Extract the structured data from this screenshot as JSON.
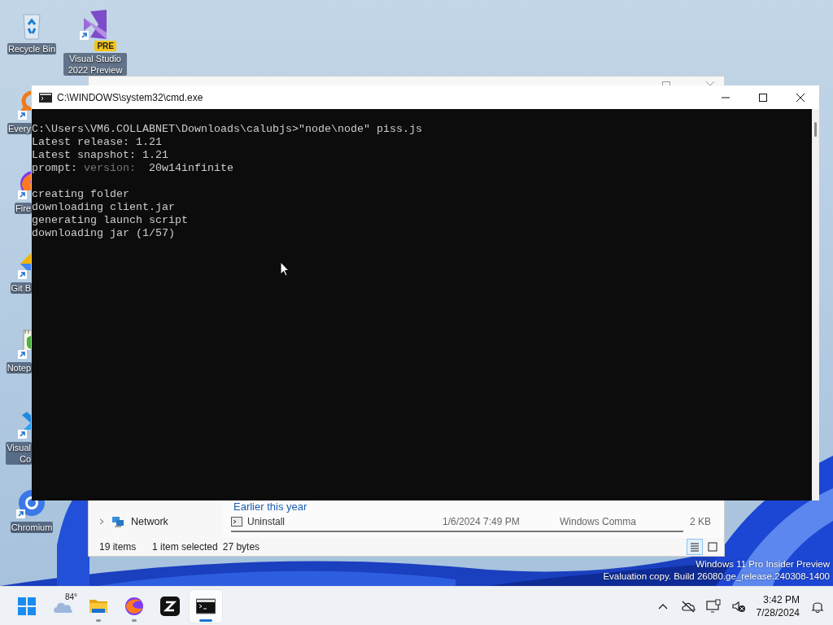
{
  "desktop_icons": [
    {
      "kind": "recycle-bin",
      "label": "Recycle Bin",
      "shortcut": false,
      "covered": false
    },
    {
      "kind": "magnifier",
      "label": "Every",
      "shortcut": true,
      "covered": true
    },
    {
      "kind": "fox",
      "label": "Fire",
      "shortcut": true,
      "covered": true
    },
    {
      "kind": "diamond",
      "label": "Git B",
      "shortcut": true,
      "covered": true
    },
    {
      "kind": "notepad",
      "label": "Notep",
      "shortcut": true,
      "covered": true
    },
    {
      "kind": "x-logo",
      "label": "Visual\nCo",
      "shortcut": true,
      "covered": true
    },
    {
      "kind": "ring",
      "label": "Chromium",
      "shortcut": true,
      "covered": false
    },
    {
      "kind": "ribbon",
      "label": "Visual Studio 2022 Preview",
      "badge": "PRE",
      "shortcut": true,
      "covered": false
    }
  ],
  "explorer_window": {
    "navigation": [
      {
        "label": "Network",
        "expanded": false
      }
    ],
    "group_header": "Earlier this year",
    "files": [
      {
        "name": "Uninstall",
        "date_modified": "1/6/2024 7:49 PM",
        "type": "Windows Comma",
        "size": "2 KB"
      }
    ],
    "status_bar": {
      "item_count": "19 items",
      "selection": "1 item selected",
      "selection_size": "27 bytes"
    },
    "view_buttons": [
      {
        "kind": "details",
        "selected": true
      },
      {
        "kind": "tiles",
        "selected": false
      }
    ]
  },
  "cmd_window": {
    "title": "C:\\WINDOWS\\system32\\cmd.exe",
    "lines": [
      {
        "segments": [
          {
            "text": "C:\\Users\\VM6.COLLABNET\\Downloads\\calubjs>\"node\\node\" piss.js",
            "dim": false
          }
        ]
      },
      {
        "segments": [
          {
            "text": "Latest release: 1.21",
            "dim": false
          }
        ]
      },
      {
        "segments": [
          {
            "text": "Latest snapshot: 1.21",
            "dim": false
          }
        ]
      },
      {
        "segments": [
          {
            "text": "prompt: ",
            "dim": false
          },
          {
            "text": "version: ",
            "dim": true
          },
          {
            "text": " 20w14infinite",
            "dim": false
          }
        ]
      },
      {
        "space_before": true,
        "segments": [
          {
            "text": "creating folder",
            "dim": false
          }
        ]
      },
      {
        "segments": [
          {
            "text": "downloading client.jar",
            "dim": false
          }
        ]
      },
      {
        "segments": [
          {
            "text": "generating launch script",
            "dim": false
          }
        ]
      },
      {
        "segments": [
          {
            "text": "downloading jar (1/57)",
            "dim": false
          }
        ]
      }
    ]
  },
  "watermark": {
    "edition": "Windows 11 Pro Insider Preview",
    "build": "Evaluation copy. Build 26080.ge_release.240308-1400"
  },
  "taskbar": {
    "apps": [
      {
        "kind": "start"
      },
      {
        "kind": "weather",
        "label": "84°"
      },
      {
        "kind": "folder",
        "running": true,
        "active": false
      },
      {
        "kind": "fox",
        "running": true,
        "active": false
      },
      {
        "kind": "z-logo",
        "running": false,
        "active": false
      },
      {
        "kind": "terminal",
        "running": true,
        "active": true
      }
    ],
    "tray": [
      {
        "kind": "chevron"
      },
      {
        "kind": "cloud-off"
      },
      {
        "kind": "monitor"
      },
      {
        "kind": "speaker-off"
      }
    ],
    "clock": {
      "time": "3:42 PM",
      "date": "7/28/2024"
    }
  }
}
